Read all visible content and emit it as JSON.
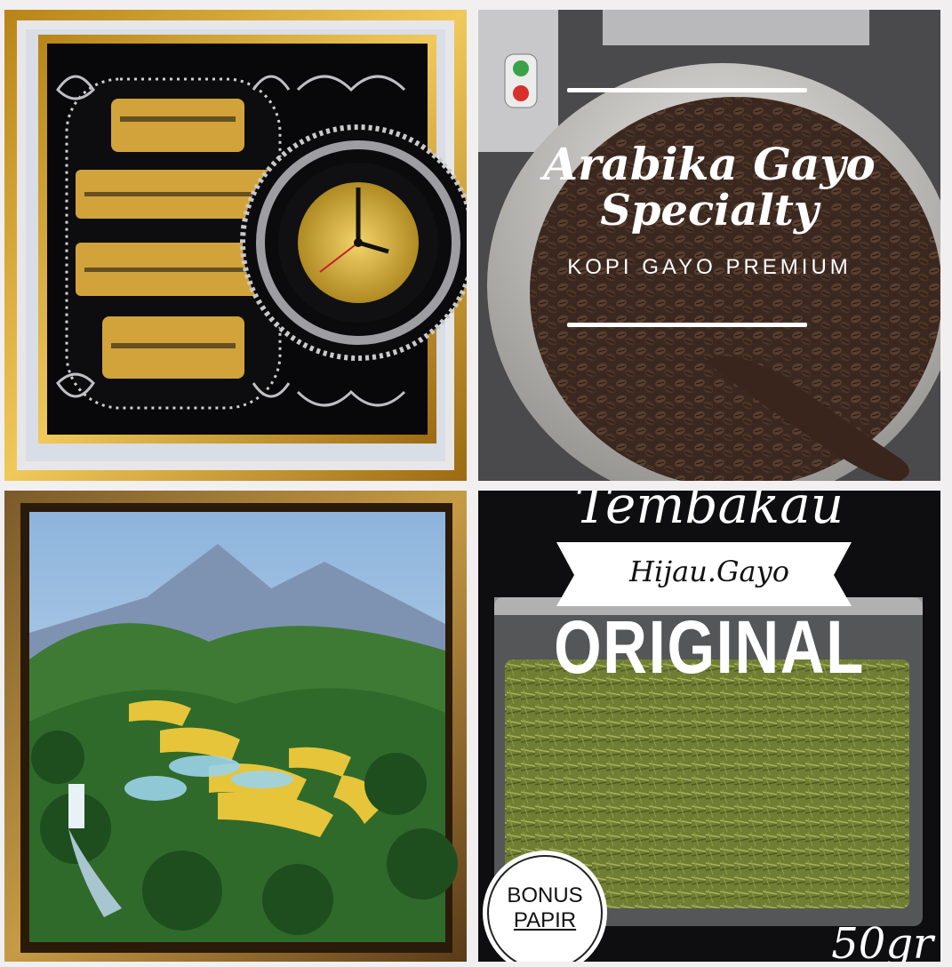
{
  "tiles": {
    "calligraphy_clock": {
      "icon": "calligraphy-clock-frame"
    },
    "coffee": {
      "title_line1": "Arabika Gayo",
      "title_line2": "Specialty",
      "subtitle": "KOPI GAYO PREMIUM"
    },
    "painting": {
      "icon": "landscape-painting"
    },
    "tobacco": {
      "top_word": "Tembakau",
      "banner": "Hijau.Gayo",
      "big_word": "ORIGINAL",
      "badge_line1": "BONUS",
      "badge_line2": "PAPIR",
      "weight": "50gr"
    }
  },
  "colors": {
    "background": "#f1eff0",
    "gold": "#d6a92e",
    "coffee": "#3b2a22",
    "leaf": "#7b8b3a"
  }
}
